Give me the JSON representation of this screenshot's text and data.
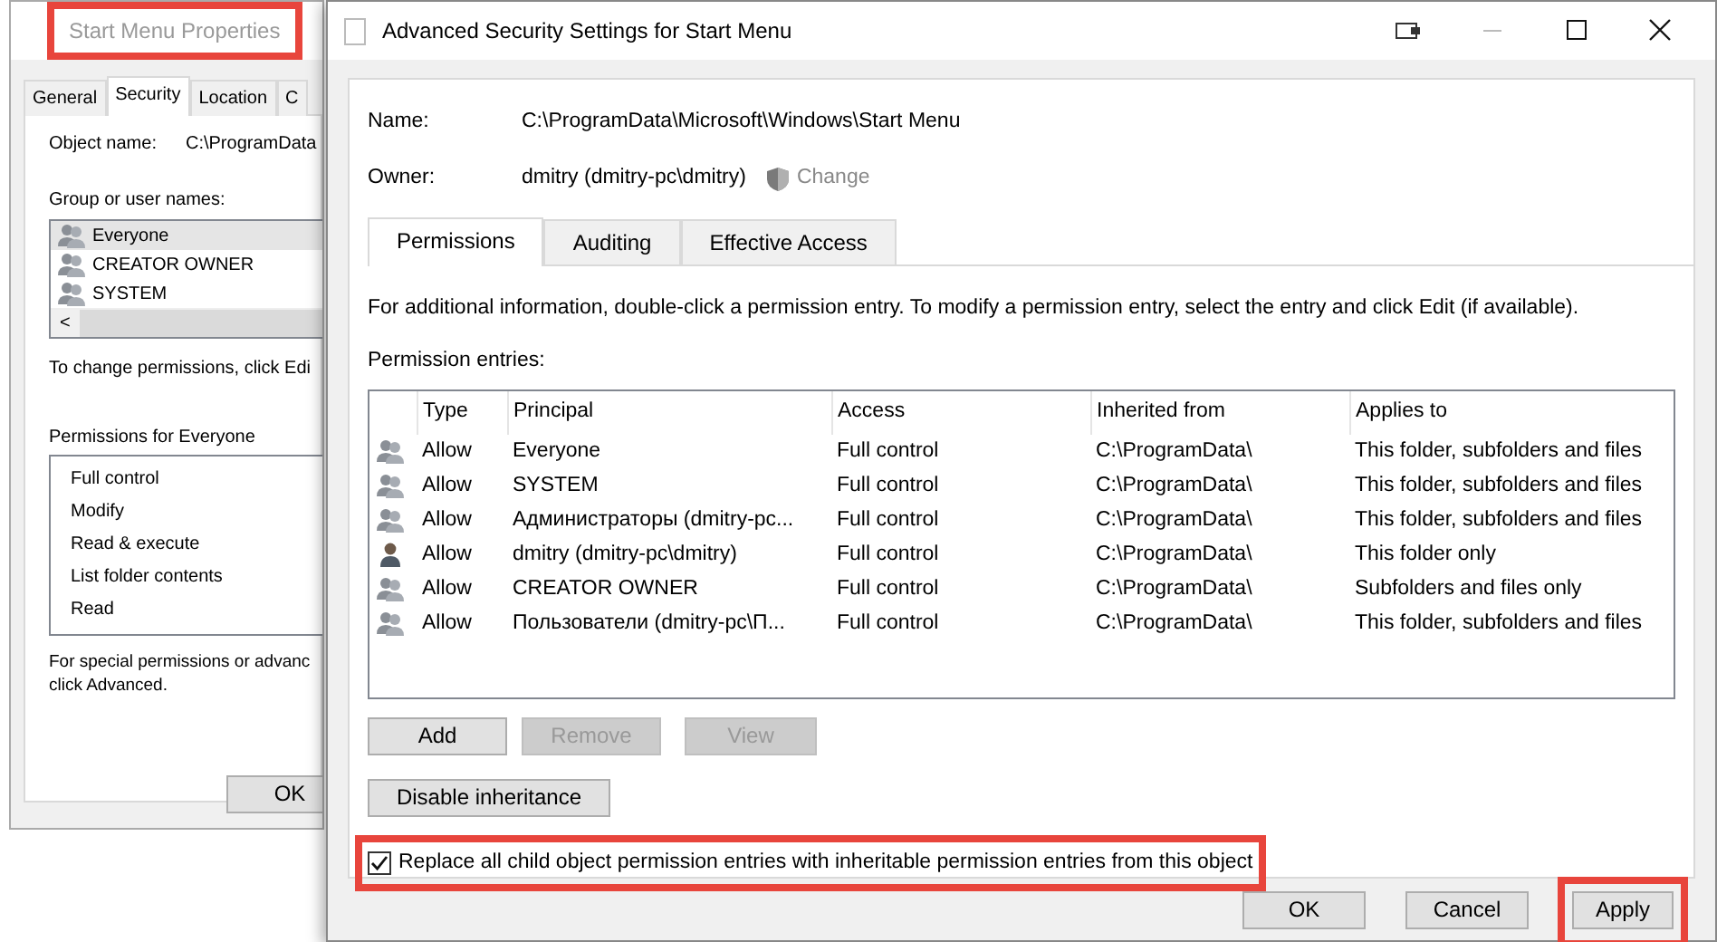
{
  "left_window": {
    "title": "Start Menu Properties",
    "title_highlighted": true,
    "tabs": [
      {
        "label": "General",
        "selected": false
      },
      {
        "label": "Security",
        "selected": true
      },
      {
        "label": "Location",
        "selected": false
      },
      {
        "label": "C",
        "selected": false
      }
    ],
    "object_name_label": "Object name:",
    "object_name": "C:\\ProgramData",
    "group_label": "Group or user names:",
    "users": [
      {
        "name": "Everyone",
        "selected": true
      },
      {
        "name": "CREATOR OWNER",
        "selected": false
      },
      {
        "name": "SYSTEM",
        "selected": false
      }
    ],
    "scroll_arrow": "<",
    "change_hint": "To change permissions, click Edi",
    "permissions_label": "Permissions for Everyone",
    "permissions": [
      "Full control",
      "Modify",
      "Read & execute",
      "List folder contents",
      "Read"
    ],
    "special_hint": "For special permissions or advanc\nclick Advanced.",
    "ok_button": "OK"
  },
  "window": {
    "title": "Advanced Security Settings for Start Menu",
    "name_label": "Name:",
    "name": "C:\\ProgramData\\Microsoft\\Windows\\Start Menu",
    "owner_label": "Owner:",
    "owner": "dmitry (dmitry-pc\\dmitry)",
    "change_link": {
      "label": "Change",
      "disabled": true
    },
    "tabs": [
      {
        "label": "Permissions",
        "selected": true
      },
      {
        "label": "Auditing",
        "selected": false
      },
      {
        "label": "Effective Access",
        "selected": false
      }
    ],
    "info": "For additional information, double-click a permission entry. To modify a permission entry, select the entry and click Edit (if available).",
    "entries_label": "Permission entries:",
    "table": {
      "columns": [
        "Type",
        "Principal",
        "Access",
        "Inherited from",
        "Applies to"
      ],
      "rows": [
        {
          "kind": "group",
          "type": "Allow",
          "principal": "Everyone",
          "access": "Full control",
          "inherited_from": "C:\\ProgramData\\",
          "applies_to": "This folder, subfolders and files"
        },
        {
          "kind": "group",
          "type": "Allow",
          "principal": "SYSTEM",
          "access": "Full control",
          "inherited_from": "C:\\ProgramData\\",
          "applies_to": "This folder, subfolders and files"
        },
        {
          "kind": "group",
          "type": "Allow",
          "principal": "Администраторы (dmitry-pc...",
          "access": "Full control",
          "inherited_from": "C:\\ProgramData\\",
          "applies_to": "This folder, subfolders and files"
        },
        {
          "kind": "user",
          "type": "Allow",
          "principal": "dmitry (dmitry-pc\\dmitry)",
          "access": "Full control",
          "inherited_from": "C:\\ProgramData\\",
          "applies_to": "This folder only"
        },
        {
          "kind": "group",
          "type": "Allow",
          "principal": "CREATOR OWNER",
          "access": "Full control",
          "inherited_from": "C:\\ProgramData\\",
          "applies_to": "Subfolders and files only"
        },
        {
          "kind": "group",
          "type": "Allow",
          "principal": "Пользователи (dmitry-pc\\П...",
          "access": "Full control",
          "inherited_from": "C:\\ProgramData\\",
          "applies_to": "This folder, subfolders and files"
        }
      ]
    },
    "entry_buttons": [
      {
        "label": "Add",
        "disabled": false
      },
      {
        "label": "Remove",
        "disabled": true
      },
      {
        "label": "View",
        "disabled": true
      }
    ],
    "disable_inheritance": "Disable inheritance",
    "replace_option": {
      "label": "Replace all child object permission entries with inheritable permission entries from this object",
      "checked": true,
      "highlighted": true
    },
    "dialog_buttons": [
      {
        "label": "OK",
        "highlighted": false
      },
      {
        "label": "Cancel",
        "highlighted": false
      },
      {
        "label": "Apply",
        "highlighted": true
      }
    ]
  }
}
